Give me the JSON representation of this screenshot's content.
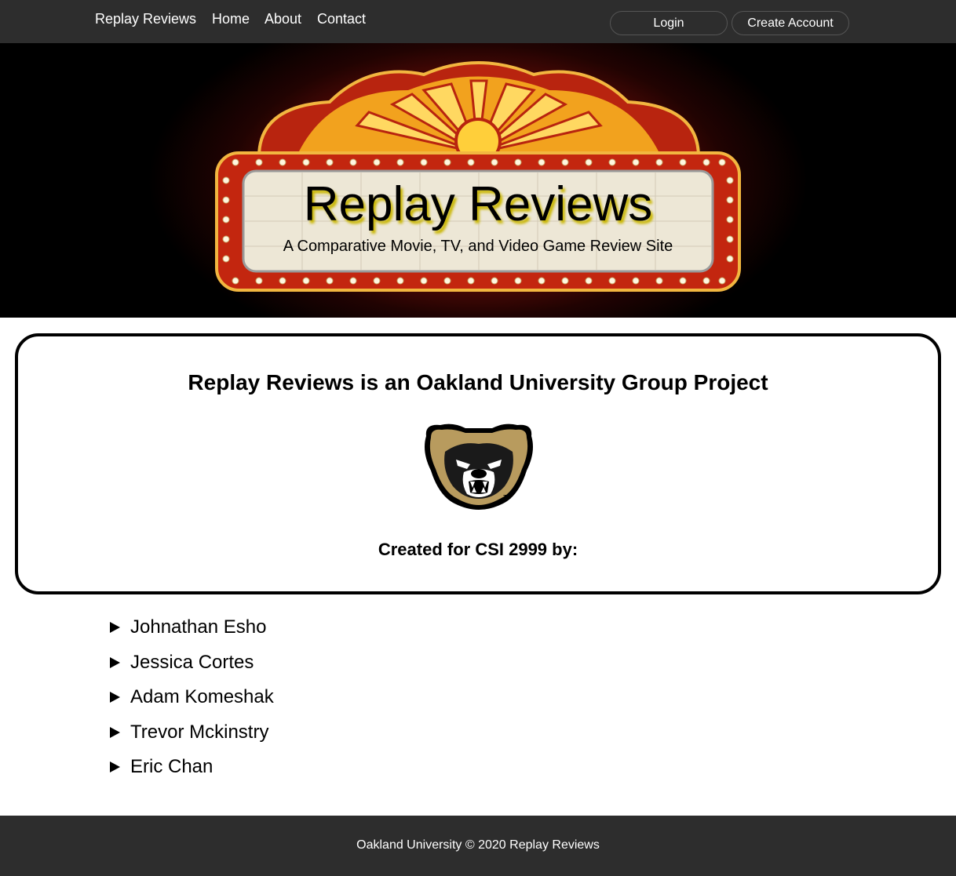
{
  "nav": {
    "brand": "Replay Reviews",
    "links": [
      "Home",
      "About",
      "Contact"
    ],
    "login_label": "Login",
    "create_account_label": "Create Account"
  },
  "hero": {
    "title": "Replay Reviews",
    "subtitle": "A Comparative Movie, TV, and Video Game Review Site"
  },
  "card": {
    "heading": "Replay Reviews is an Oakland University Group Project",
    "logo_icon": "grizzly-bear-logo",
    "subheading": "Created for CSI 2999 by:"
  },
  "members": [
    "Johnathan Esho",
    "Jessica Cortes",
    "Adam Komeshak",
    "Trevor Mckinstry",
    "Eric Chan"
  ],
  "footer": {
    "text": "Oakland University © 2020 Replay Reviews"
  },
  "colors": {
    "nav_bg": "#2d2d2d",
    "marquee_red": "#c0301b",
    "marquee_gold": "#f2a21e",
    "bear_gold": "#b89b5e"
  }
}
